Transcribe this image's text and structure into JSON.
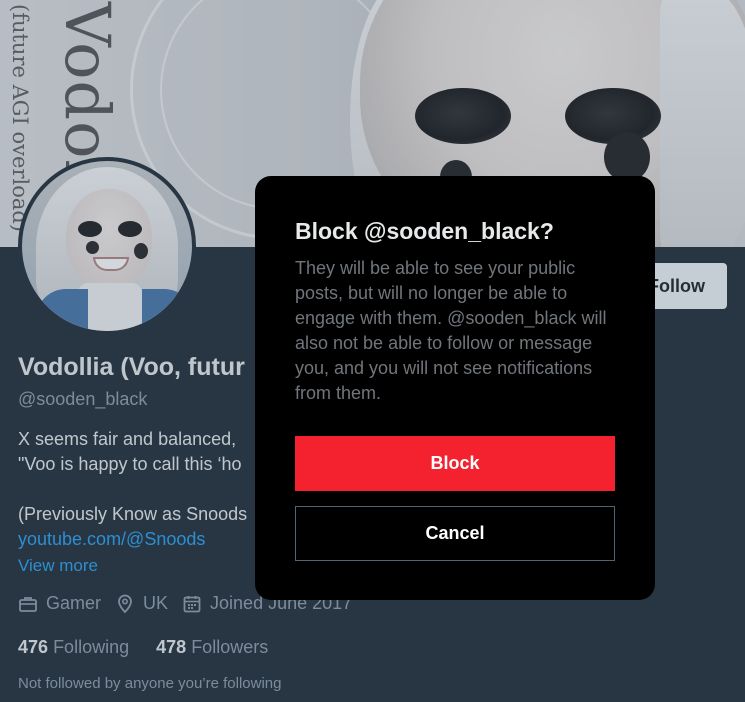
{
  "banner": {
    "title_text": "Vodolli",
    "subtitle_text": "(future AGI overload)"
  },
  "profile": {
    "display_name": "Vodollia (Voo, futur",
    "handle": "@sooden_black",
    "follow_label": "Follow",
    "bio_lines": [
      "X seems fair and balanced,",
      "\"Voo is happy to call this ‘ho",
      "",
      "(Previously Know as Snoods"
    ],
    "bio_link": "youtube.com/@Snoods",
    "view_more": "View more",
    "meta": {
      "category": "Gamer",
      "location": "UK",
      "joined": "Joined June 2017"
    },
    "following_count": "476",
    "following_label": "Following",
    "followers_count": "478",
    "followers_label": "Followers",
    "not_followed_text": "Not followed by anyone you’re following"
  },
  "modal": {
    "title": "Block @sooden_black?",
    "body": "They will be able to see your public posts, but will no longer be able to engage with them. @sooden_black will also not be able to follow or message you, and you will not see notifications from them.",
    "block_label": "Block",
    "cancel_label": "Cancel"
  },
  "colors": {
    "background": "#15202b",
    "accent_link": "#1d9bf0",
    "danger": "#f4212e",
    "modal_bg": "#000000"
  }
}
